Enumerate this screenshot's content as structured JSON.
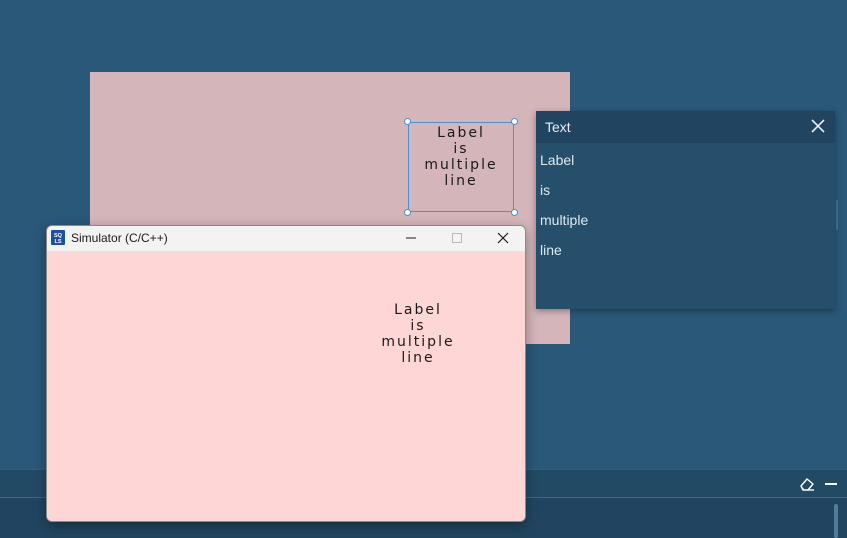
{
  "design": {
    "label_lines": [
      "Label",
      "is",
      "multiple",
      "line"
    ]
  },
  "text_panel": {
    "title": "Text",
    "lines": [
      "Label",
      "is",
      "multiple",
      "line"
    ],
    "close_icon": "close-icon"
  },
  "simulator": {
    "title": "Simulator (C/C++)",
    "label_lines": [
      "Label",
      "is",
      "multiple",
      "line"
    ],
    "buttons": [
      "minimize-icon",
      "maximize-icon",
      "close-icon"
    ]
  },
  "bottom_bar": {
    "icons": [
      "eraser-icon",
      "minimize-icon"
    ]
  },
  "colors": {
    "workspace_bg": "#2a5878",
    "design_canvas_bg": "#d4b5b9",
    "simulator_bg": "#ffd6d6",
    "selection_border": "#4a90d9",
    "panel_bg": "#264f6b"
  }
}
